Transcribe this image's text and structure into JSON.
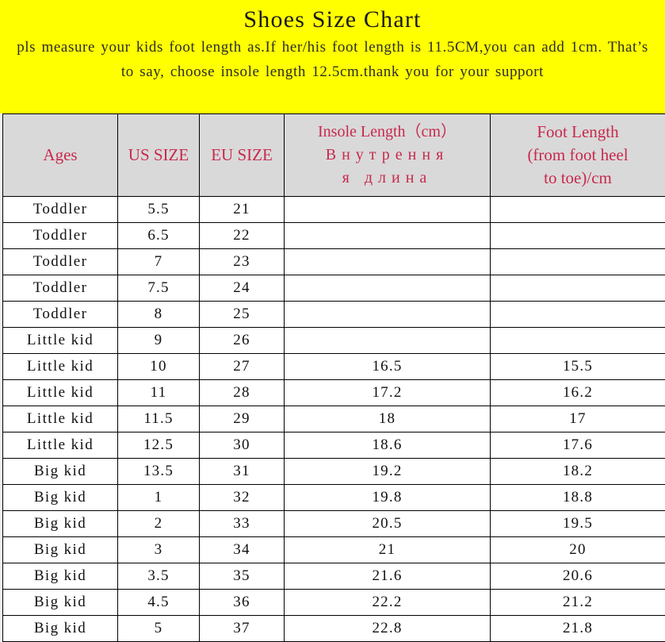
{
  "banner": {
    "title": "Shoes Size Chart",
    "note_line1": "pls measure your kids foot length as.If her/his foot length is 11.5CM,you",
    "note_line2": "can add 1cm. That’s to say, choose insole length 12.5cm.thank you for your",
    "note_line3": "support",
    "background_color": "#ffff00",
    "title_color": "#1a1a1a"
  },
  "table": {
    "header_background": "#d9d9d9",
    "header_text_color": "#c8294c",
    "border_color": "#000000",
    "columns": [
      {
        "key": "ages",
        "label": "Ages"
      },
      {
        "key": "us_size",
        "label": "US SIZE"
      },
      {
        "key": "eu_size",
        "label": "EU SIZE"
      },
      {
        "key": "insole_length",
        "label_line1": "Insole Length（cm）",
        "label_line2": "Внутрення",
        "label_line3": "я длина"
      },
      {
        "key": "foot_length",
        "label_line1": "Foot Length",
        "label_line2": "(from foot heel",
        "label_line3": "to toe)/cm"
      }
    ],
    "rows": [
      {
        "ages": "Toddler",
        "us_size": "5.5",
        "eu_size": "21",
        "insole_length": "",
        "foot_length": ""
      },
      {
        "ages": "Toddler",
        "us_size": "6.5",
        "eu_size": "22",
        "insole_length": "",
        "foot_length": ""
      },
      {
        "ages": "Toddler",
        "us_size": "7",
        "eu_size": "23",
        "insole_length": "",
        "foot_length": ""
      },
      {
        "ages": "Toddler",
        "us_size": "7.5",
        "eu_size": "24",
        "insole_length": "",
        "foot_length": ""
      },
      {
        "ages": "Toddler",
        "us_size": "8",
        "eu_size": "25",
        "insole_length": "",
        "foot_length": ""
      },
      {
        "ages": "Little kid",
        "us_size": "9",
        "eu_size": "26",
        "insole_length": "",
        "foot_length": ""
      },
      {
        "ages": "Little kid",
        "us_size": "10",
        "eu_size": "27",
        "insole_length": "16.5",
        "foot_length": "15.5"
      },
      {
        "ages": "Little kid",
        "us_size": "11",
        "eu_size": "28",
        "insole_length": "17.2",
        "foot_length": "16.2"
      },
      {
        "ages": "Little kid",
        "us_size": "11.5",
        "eu_size": "29",
        "insole_length": "18",
        "foot_length": "17"
      },
      {
        "ages": "Little kid",
        "us_size": "12.5",
        "eu_size": "30",
        "insole_length": "18.6",
        "foot_length": "17.6"
      },
      {
        "ages": "Big kid",
        "us_size": "13.5",
        "eu_size": "31",
        "insole_length": "19.2",
        "foot_length": "18.2"
      },
      {
        "ages": "Big kid",
        "us_size": "1",
        "eu_size": "32",
        "insole_length": "19.8",
        "foot_length": "18.8"
      },
      {
        "ages": "Big kid",
        "us_size": "2",
        "eu_size": "33",
        "insole_length": "20.5",
        "foot_length": "19.5"
      },
      {
        "ages": "Big kid",
        "us_size": "3",
        "eu_size": "34",
        "insole_length": "21",
        "foot_length": "20"
      },
      {
        "ages": "Big kid",
        "us_size": "3.5",
        "eu_size": "35",
        "insole_length": "21.6",
        "foot_length": "20.6"
      },
      {
        "ages": "Big kid",
        "us_size": "4.5",
        "eu_size": "36",
        "insole_length": "22.2",
        "foot_length": "21.2"
      },
      {
        "ages": "Big kid",
        "us_size": "5",
        "eu_size": "37",
        "insole_length": "22.8",
        "foot_length": "21.8"
      }
    ]
  }
}
